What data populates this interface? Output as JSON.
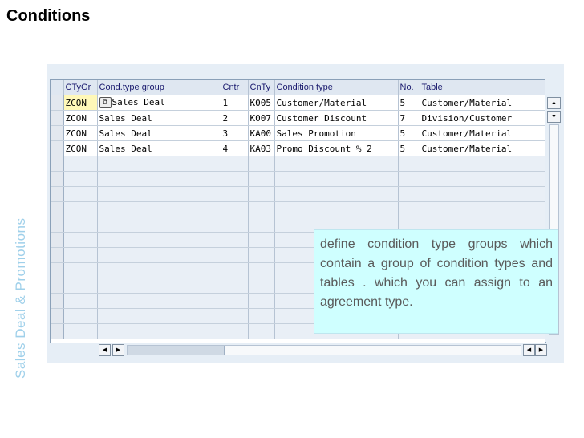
{
  "slide": {
    "title": "Conditions",
    "side_label": "Sales Deal & Promotions"
  },
  "table": {
    "columns": [
      "CTyGr",
      "Cond.type group",
      "Cntr",
      "CnTy",
      "Condition type",
      "No.",
      "Table"
    ],
    "rows": [
      {
        "ctygr": "ZCON",
        "cond_type_group": "Sales Deal",
        "cntr": "1",
        "cnty": "K005",
        "condition_type": "Customer/Material",
        "no": "5",
        "table": "Customer/Material"
      },
      {
        "ctygr": "ZCON",
        "cond_type_group": "Sales Deal",
        "cntr": "2",
        "cnty": "K007",
        "condition_type": "Customer Discount",
        "no": "7",
        "table": "Division/Customer"
      },
      {
        "ctygr": "ZCON",
        "cond_type_group": "Sales Deal",
        "cntr": "3",
        "cnty": "KA00",
        "condition_type": "Sales Promotion",
        "no": "5",
        "table": "Customer/Material"
      },
      {
        "ctygr": "ZCON",
        "cond_type_group": "Sales Deal",
        "cntr": "4",
        "cnty": "KA03",
        "condition_type": "Promo Discount % 2",
        "no": "5",
        "table": "Customer/Material"
      }
    ],
    "empty_rows": 12
  },
  "callout": {
    "text": "define condition type groups which contain a group of condition types  and tables . which you can assign to an agreement type."
  },
  "icons": {
    "config": "table-settings-icon",
    "up": "scroll-up-icon",
    "down": "scroll-down-icon",
    "left": "scroll-left-icon",
    "right": "scroll-right-icon",
    "matchcode": "value-help-icon"
  },
  "colors": {
    "grid_bg": "#e6eef6",
    "header_bg": "#dfe7f1",
    "highlight": "#fff8b8",
    "callout_bg": "#cfffff",
    "side_label": "#9fd0ea"
  }
}
